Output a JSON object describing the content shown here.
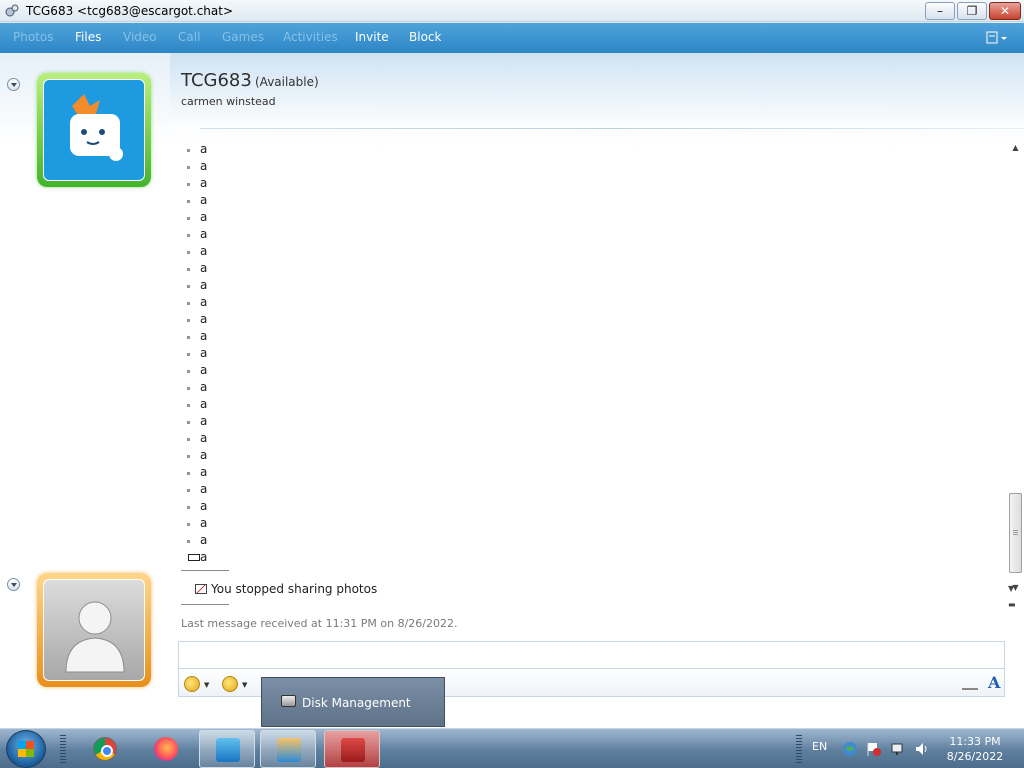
{
  "window": {
    "title": "TCG683 <tcg683@escargot.chat>",
    "controls": {
      "minimize": "–",
      "maximize": "❐",
      "close": "✕"
    }
  },
  "menu": {
    "items": [
      {
        "label": "Photos",
        "enabled": false
      },
      {
        "label": "Files",
        "enabled": true
      },
      {
        "label": "Video",
        "enabled": false
      },
      {
        "label": "Call",
        "enabled": false
      },
      {
        "label": "Games",
        "enabled": false
      },
      {
        "label": "Activities",
        "enabled": false
      },
      {
        "label": "Invite",
        "enabled": true
      },
      {
        "label": "Block",
        "enabled": true
      }
    ],
    "options_icon": "options-menu-icon"
  },
  "contact": {
    "name": "TCG683",
    "status": "(Available)",
    "personal_message": "carmen winstead"
  },
  "conversation": {
    "lines": [
      "a",
      "a",
      "a",
      "a",
      "a",
      "a",
      "a",
      "a",
      "a",
      "a",
      "a",
      "a",
      "a",
      "a",
      "a",
      "a",
      "a",
      "a",
      "a",
      "a",
      "a",
      "a",
      "a",
      "a",
      "a"
    ],
    "system_message": "You stopped sharing photos",
    "last_received": "Last message received at 11:31 PM on 8/26/2022."
  },
  "input": {
    "value": "",
    "emoticon_icon": "smiley-icon",
    "wink_icon": "wink-icon",
    "handwriting_icon": "pen-icon",
    "font_label": "A"
  },
  "popup": {
    "label": "Disk Management"
  },
  "taskbar": {
    "apps": [
      "chrome-icon",
      "firefox-icon",
      "gears-icon",
      "messenger-icon",
      "toolbox-icon"
    ],
    "language": "EN",
    "time": "11:33 PM",
    "date": "8/26/2022"
  },
  "colors": {
    "menubar": "#3796d2",
    "contact_frame_online": "#42b42b",
    "user_frame": "#e98f1a"
  }
}
